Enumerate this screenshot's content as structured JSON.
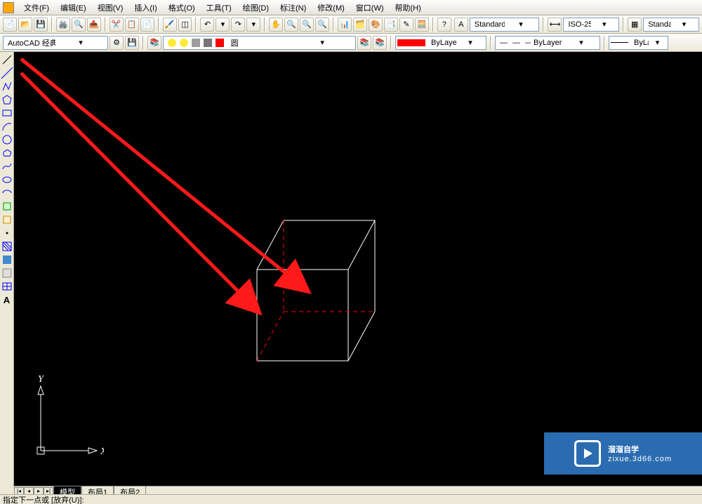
{
  "menu": {
    "items": [
      "文件(F)",
      "编辑(E)",
      "视图(V)",
      "插入(I)",
      "格式(O)",
      "工具(T)",
      "绘图(D)",
      "标注(N)",
      "修改(M)",
      "窗口(W)",
      "帮助(H)"
    ]
  },
  "row1": {
    "text_style": "Standard",
    "dim_style": "ISO-25",
    "table_style": "Standard"
  },
  "row2": {
    "workspace": "AutoCAD 经典",
    "layer": "圆",
    "color": "ByLayer",
    "linetype": "ByLayer",
    "lineweight": "ByLayer"
  },
  "left_tools": [
    "line",
    "xline",
    "polyline",
    "polygon",
    "rectangle",
    "arc",
    "circle",
    "spline",
    "ellipse",
    "ellipse-arc",
    "block",
    "point",
    "hatch",
    "gradient",
    "region",
    "table",
    "text"
  ],
  "tabs": {
    "model": "模型",
    "layout1": "布局1",
    "layout2": "布局2"
  },
  "cmd": "指定下一点或 [放弃(U)]:",
  "ucs": {
    "x": "X",
    "y": "Y"
  },
  "watermark": {
    "title": "溜溜自学",
    "sub": "zixue.3d66.com"
  }
}
